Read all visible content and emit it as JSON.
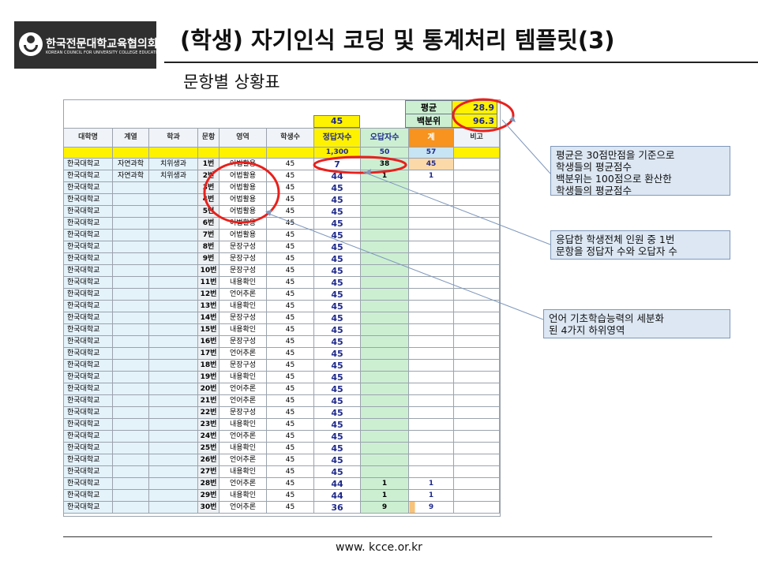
{
  "logo": {
    "name": "한국전문대학교육협의회",
    "subtitle": "KOREAN COUNCIL FOR UNIVERSITY COLLEGE EDUCATION"
  },
  "title": "(학생) 자기인식 코딩 및 통계처리 템플릿(3)",
  "subtitle": "문항별 상황표",
  "summary": [
    {
      "label": "평균",
      "value": "28.9"
    },
    {
      "label": "백분위",
      "value": "96.3"
    }
  ],
  "header_top_value": "45",
  "columns": [
    "대학명",
    "계열",
    "학과",
    "문항",
    "영역",
    "학생수",
    "정답자수",
    "오답자수",
    "계",
    "비고"
  ],
  "totals": {
    "correct": "1,300",
    "wrong": "50",
    "sum": "57"
  },
  "rows": [
    {
      "uni": "한국대학교",
      "series": "자연과학",
      "dept": "치위생과",
      "q": "1번",
      "area": "어법활용",
      "students": "45",
      "correct": "7",
      "wrong": "38",
      "sum": "45"
    },
    {
      "uni": "한국대학교",
      "series": "자연과학",
      "dept": "치위생과",
      "q": "2번",
      "area": "어법활용",
      "students": "45",
      "correct": "44",
      "wrong": "1",
      "sum": "1"
    },
    {
      "uni": "한국대학교",
      "series": "",
      "dept": "",
      "q": "3번",
      "area": "어법활용",
      "students": "45",
      "correct": "45",
      "wrong": "",
      "sum": ""
    },
    {
      "uni": "한국대학교",
      "series": "",
      "dept": "",
      "q": "4번",
      "area": "어법활용",
      "students": "45",
      "correct": "45",
      "wrong": "",
      "sum": ""
    },
    {
      "uni": "한국대학교",
      "series": "",
      "dept": "",
      "q": "5번",
      "area": "어법활용",
      "students": "45",
      "correct": "45",
      "wrong": "",
      "sum": ""
    },
    {
      "uni": "한국대학교",
      "series": "",
      "dept": "",
      "q": "6번",
      "area": "어법활용",
      "students": "45",
      "correct": "45",
      "wrong": "",
      "sum": ""
    },
    {
      "uni": "한국대학교",
      "series": "",
      "dept": "",
      "q": "7번",
      "area": "어법활용",
      "students": "45",
      "correct": "45",
      "wrong": "",
      "sum": ""
    },
    {
      "uni": "한국대학교",
      "series": "",
      "dept": "",
      "q": "8번",
      "area": "문장구성",
      "students": "45",
      "correct": "45",
      "wrong": "",
      "sum": ""
    },
    {
      "uni": "한국대학교",
      "series": "",
      "dept": "",
      "q": "9번",
      "area": "문장구성",
      "students": "45",
      "correct": "45",
      "wrong": "",
      "sum": ""
    },
    {
      "uni": "한국대학교",
      "series": "",
      "dept": "",
      "q": "10번",
      "area": "문장구성",
      "students": "45",
      "correct": "45",
      "wrong": "",
      "sum": ""
    },
    {
      "uni": "한국대학교",
      "series": "",
      "dept": "",
      "q": "11번",
      "area": "내용확인",
      "students": "45",
      "correct": "45",
      "wrong": "",
      "sum": ""
    },
    {
      "uni": "한국대학교",
      "series": "",
      "dept": "",
      "q": "12번",
      "area": "언어추론",
      "students": "45",
      "correct": "45",
      "wrong": "",
      "sum": ""
    },
    {
      "uni": "한국대학교",
      "series": "",
      "dept": "",
      "q": "13번",
      "area": "내용확인",
      "students": "45",
      "correct": "45",
      "wrong": "",
      "sum": ""
    },
    {
      "uni": "한국대학교",
      "series": "",
      "dept": "",
      "q": "14번",
      "area": "문장구성",
      "students": "45",
      "correct": "45",
      "wrong": "",
      "sum": ""
    },
    {
      "uni": "한국대학교",
      "series": "",
      "dept": "",
      "q": "15번",
      "area": "내용확인",
      "students": "45",
      "correct": "45",
      "wrong": "",
      "sum": ""
    },
    {
      "uni": "한국대학교",
      "series": "",
      "dept": "",
      "q": "16번",
      "area": "문장구성",
      "students": "45",
      "correct": "45",
      "wrong": "",
      "sum": ""
    },
    {
      "uni": "한국대학교",
      "series": "",
      "dept": "",
      "q": "17번",
      "area": "언어추론",
      "students": "45",
      "correct": "45",
      "wrong": "",
      "sum": ""
    },
    {
      "uni": "한국대학교",
      "series": "",
      "dept": "",
      "q": "18번",
      "area": "문장구성",
      "students": "45",
      "correct": "45",
      "wrong": "",
      "sum": ""
    },
    {
      "uni": "한국대학교",
      "series": "",
      "dept": "",
      "q": "19번",
      "area": "내용확인",
      "students": "45",
      "correct": "45",
      "wrong": "",
      "sum": ""
    },
    {
      "uni": "한국대학교",
      "series": "",
      "dept": "",
      "q": "20번",
      "area": "언어추론",
      "students": "45",
      "correct": "45",
      "wrong": "",
      "sum": ""
    },
    {
      "uni": "한국대학교",
      "series": "",
      "dept": "",
      "q": "21번",
      "area": "언어추론",
      "students": "45",
      "correct": "45",
      "wrong": "",
      "sum": ""
    },
    {
      "uni": "한국대학교",
      "series": "",
      "dept": "",
      "q": "22번",
      "area": "문장구성",
      "students": "45",
      "correct": "45",
      "wrong": "",
      "sum": ""
    },
    {
      "uni": "한국대학교",
      "series": "",
      "dept": "",
      "q": "23번",
      "area": "내용확인",
      "students": "45",
      "correct": "45",
      "wrong": "",
      "sum": ""
    },
    {
      "uni": "한국대학교",
      "series": "",
      "dept": "",
      "q": "24번",
      "area": "언어추론",
      "students": "45",
      "correct": "45",
      "wrong": "",
      "sum": ""
    },
    {
      "uni": "한국대학교",
      "series": "",
      "dept": "",
      "q": "25번",
      "area": "내용확인",
      "students": "45",
      "correct": "45",
      "wrong": "",
      "sum": ""
    },
    {
      "uni": "한국대학교",
      "series": "",
      "dept": "",
      "q": "26번",
      "area": "언어추론",
      "students": "45",
      "correct": "45",
      "wrong": "",
      "sum": ""
    },
    {
      "uni": "한국대학교",
      "series": "",
      "dept": "",
      "q": "27번",
      "area": "내용확인",
      "students": "45",
      "correct": "45",
      "wrong": "",
      "sum": ""
    },
    {
      "uni": "한국대학교",
      "series": "",
      "dept": "",
      "q": "28번",
      "area": "언어추론",
      "students": "45",
      "correct": "44",
      "wrong": "1",
      "sum": "1"
    },
    {
      "uni": "한국대학교",
      "series": "",
      "dept": "",
      "q": "29번",
      "area": "내용확인",
      "students": "45",
      "correct": "44",
      "wrong": "1",
      "sum": "1"
    },
    {
      "uni": "한국대학교",
      "series": "",
      "dept": "",
      "q": "30번",
      "area": "언어추론",
      "students": "45",
      "correct": "36",
      "wrong": "9",
      "sum": "9"
    }
  ],
  "callouts": [
    {
      "lines": [
        "평균은 30점만점을 기준으로",
        "학생들의 평균점수",
        "백분위는 100점으로 환산한",
        "학생들의 평균점수"
      ]
    },
    {
      "lines": [
        "응답한 학생전체 인원 중 1번",
        "문항을 정답자 수와 오답자 수"
      ]
    },
    {
      "lines": [
        "언어 기초학습능력의 세분화",
        "된 4가지 하위영역"
      ]
    }
  ],
  "footer_url": "www. kcce.or.kr",
  "colors": {
    "header_yellow": "#fff200",
    "wrong_green": "#ccefd2",
    "sum_orange": "#f7931e",
    "callout_bg": "#dce7f3",
    "annotation_red": "#e8201c"
  }
}
